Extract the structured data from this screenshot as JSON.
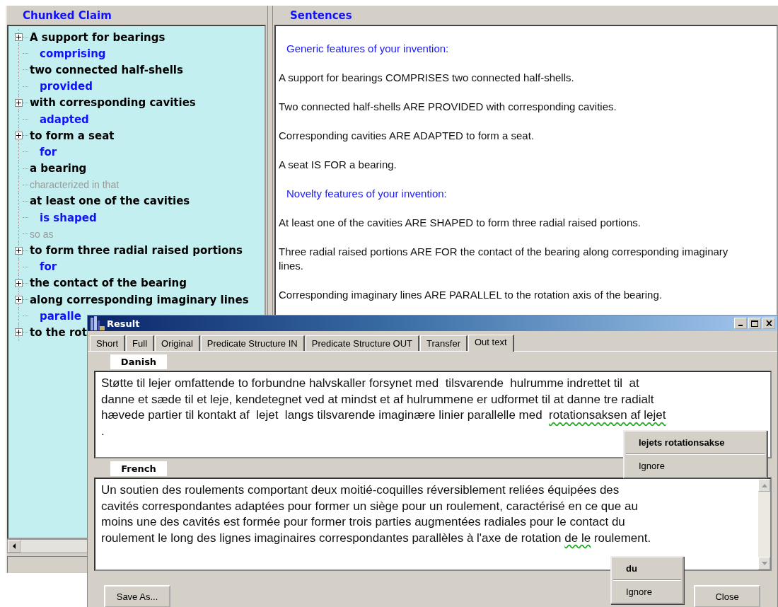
{
  "main_window": {
    "claim_panel": {
      "title": "Chunked Claim",
      "items": [
        {
          "text": "A support for bearings",
          "kind": "phrase",
          "expandable": true
        },
        {
          "text": "comprising",
          "kind": "relation",
          "expandable": false
        },
        {
          "text": "two connected half-shells",
          "kind": "phrase",
          "expandable": false
        },
        {
          "text": "provided",
          "kind": "relation",
          "expandable": false
        },
        {
          "text": "with corresponding cavities",
          "kind": "phrase",
          "expandable": true
        },
        {
          "text": "adapted",
          "kind": "relation",
          "expandable": false
        },
        {
          "text": "to form a seat",
          "kind": "phrase",
          "expandable": true
        },
        {
          "text": "for",
          "kind": "relation",
          "expandable": false
        },
        {
          "text": "a bearing",
          "kind": "phrase",
          "expandable": false
        },
        {
          "text": "characterized in that",
          "kind": "connector",
          "expandable": false
        },
        {
          "text": "at least one of the cavities",
          "kind": "phrase",
          "expandable": false
        },
        {
          "text": "is shaped",
          "kind": "relation",
          "expandable": false
        },
        {
          "text": "so as",
          "kind": "connector",
          "expandable": false
        },
        {
          "text": "to form three radial raised portions",
          "kind": "phrase",
          "expandable": true
        },
        {
          "text": "for",
          "kind": "relation",
          "expandable": false
        },
        {
          "text": "the contact of the bearing",
          "kind": "phrase",
          "expandable": true
        },
        {
          "text": "along corresponding imaginary lines",
          "kind": "phrase",
          "expandable": true
        },
        {
          "text": "paralle",
          "kind": "relation",
          "expandable": false
        },
        {
          "text": "to the rot",
          "kind": "phrase",
          "expandable": true
        }
      ]
    },
    "sentences_panel": {
      "title": "Sentences",
      "items": [
        {
          "text": "Generic features of your invention:",
          "kind": "heading"
        },
        {
          "text": "A support for bearings COMPRISES two connected half-shells.",
          "kind": "sentence"
        },
        {
          "text": "Two connected half-shells ARE PROVIDED with corresponding cavities.",
          "kind": "sentence"
        },
        {
          "text": "Corresponding cavities ARE ADAPTED to form a seat.",
          "kind": "sentence"
        },
        {
          "text": "A seat IS FOR a bearing.",
          "kind": "sentence"
        },
        {
          "text": "Novelty features of your invention:",
          "kind": "heading"
        },
        {
          "text": "At least one of the cavities ARE SHAPED to form three radial raised portions.",
          "kind": "sentence"
        },
        {
          "text": "Three radial raised portions ARE FOR the contact of the bearing along corresponding imaginary lines.",
          "kind": "sentence"
        },
        {
          "text": "Corresponding imaginary lines ARE PARALLEL to the rotation axis of the bearing.",
          "kind": "sentence"
        }
      ]
    }
  },
  "result_dialog": {
    "title": "Result",
    "tabs": [
      {
        "label": "Short",
        "selected": false
      },
      {
        "label": "Full",
        "selected": false
      },
      {
        "label": "Original",
        "selected": false
      },
      {
        "label": "Predicate Structure IN",
        "selected": false
      },
      {
        "label": "Predicate Structure OUT",
        "selected": false
      },
      {
        "label": "Transfer",
        "selected": false
      },
      {
        "label": "Out text",
        "selected": true
      }
    ],
    "outputs": [
      {
        "language": "Danish",
        "scrollbar": false,
        "lines": [
          [
            {
              "text": "Støtte til lejer omfattende to forbundne halvskaller forsynet med  tilsvarende  hulrumme indrettet til  at",
              "flagged": false
            }
          ],
          [
            {
              "text": "danne et sæde til et leje, kendetegnet ved at mindst et af hulrummene er udformet til at danne tre radialt",
              "flagged": false
            }
          ],
          [
            {
              "text": "hævede partier til kontakt af  lejet  langs tilsvarende imaginære linier parallelle med  ",
              "flagged": false
            },
            {
              "text": "rotationsaksen af lejet",
              "flagged": true
            }
          ],
          [
            {
              "text": ".",
              "flagged": false
            }
          ]
        ],
        "menu": [
          {
            "label": "lejets rotationsakse",
            "kind": "suggestion"
          },
          {
            "label": "Ignore",
            "kind": "ignore"
          }
        ]
      },
      {
        "language": "French",
        "scrollbar": true,
        "lines": [
          [
            {
              "text": "Un soutien des roulements comportant deux moitié-coquilles réversiblement reliées équipées des",
              "flagged": false
            }
          ],
          [
            {
              "text": "cavités correspondantes adaptées pour former un siège pour un roulement, caractérisé en ce que au",
              "flagged": false
            }
          ],
          [
            {
              "text": "moins une des cavités est formée pour former trois parties augmentées radiales pour le contact du",
              "flagged": false
            }
          ],
          [
            {
              "text": "roulement le long des lignes imaginaires correspondantes parallèles à l'axe de rotation ",
              "flagged": false
            },
            {
              "text": "de le",
              "flagged": true
            },
            {
              "text": " roulement.",
              "flagged": false
            }
          ]
        ],
        "menu": [
          {
            "label": "du",
            "kind": "suggestion"
          },
          {
            "label": "Ignore",
            "kind": "ignore"
          }
        ]
      }
    ],
    "buttons": [
      "Save As...",
      "Close"
    ]
  }
}
